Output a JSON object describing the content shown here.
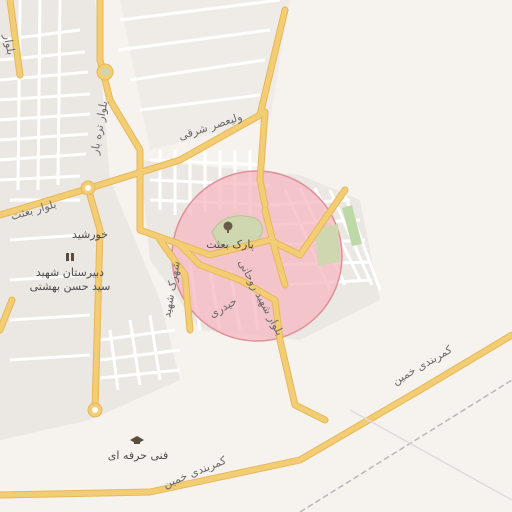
{
  "map": {
    "roads": {
      "valiasr": "ولیعصر شرقی",
      "tarbiat": "بلوار تره بار",
      "besat": "بلوار بعثت",
      "shahid_rouhani": "بلوار شهید روحانی",
      "heydari": "حیدری",
      "shahid_road": "شهرک شهید",
      "khomein_1": "کمربندی خمین",
      "khomein_2": "کمربندی خمین",
      "top_left": "بلوار"
    },
    "pois": {
      "park": "پارک بعثت",
      "park_icon": "park-tree-icon",
      "khorshid": "خورشید",
      "school_line1": "دبیرستان شهید",
      "school_line2": "سید حسن بهشتی",
      "school_icon": "school-building-icon",
      "technical": "فنی حرفه ای",
      "technical_icon": "graduation-cap-icon"
    },
    "colors": {
      "background": "#f6f3ee",
      "road_major": "#f3cd73",
      "road_minor": "#ffffff",
      "highlight_fill": "#f5b8c0",
      "highlight_stroke": "#e0909a",
      "park": "#cfd7b0"
    }
  }
}
